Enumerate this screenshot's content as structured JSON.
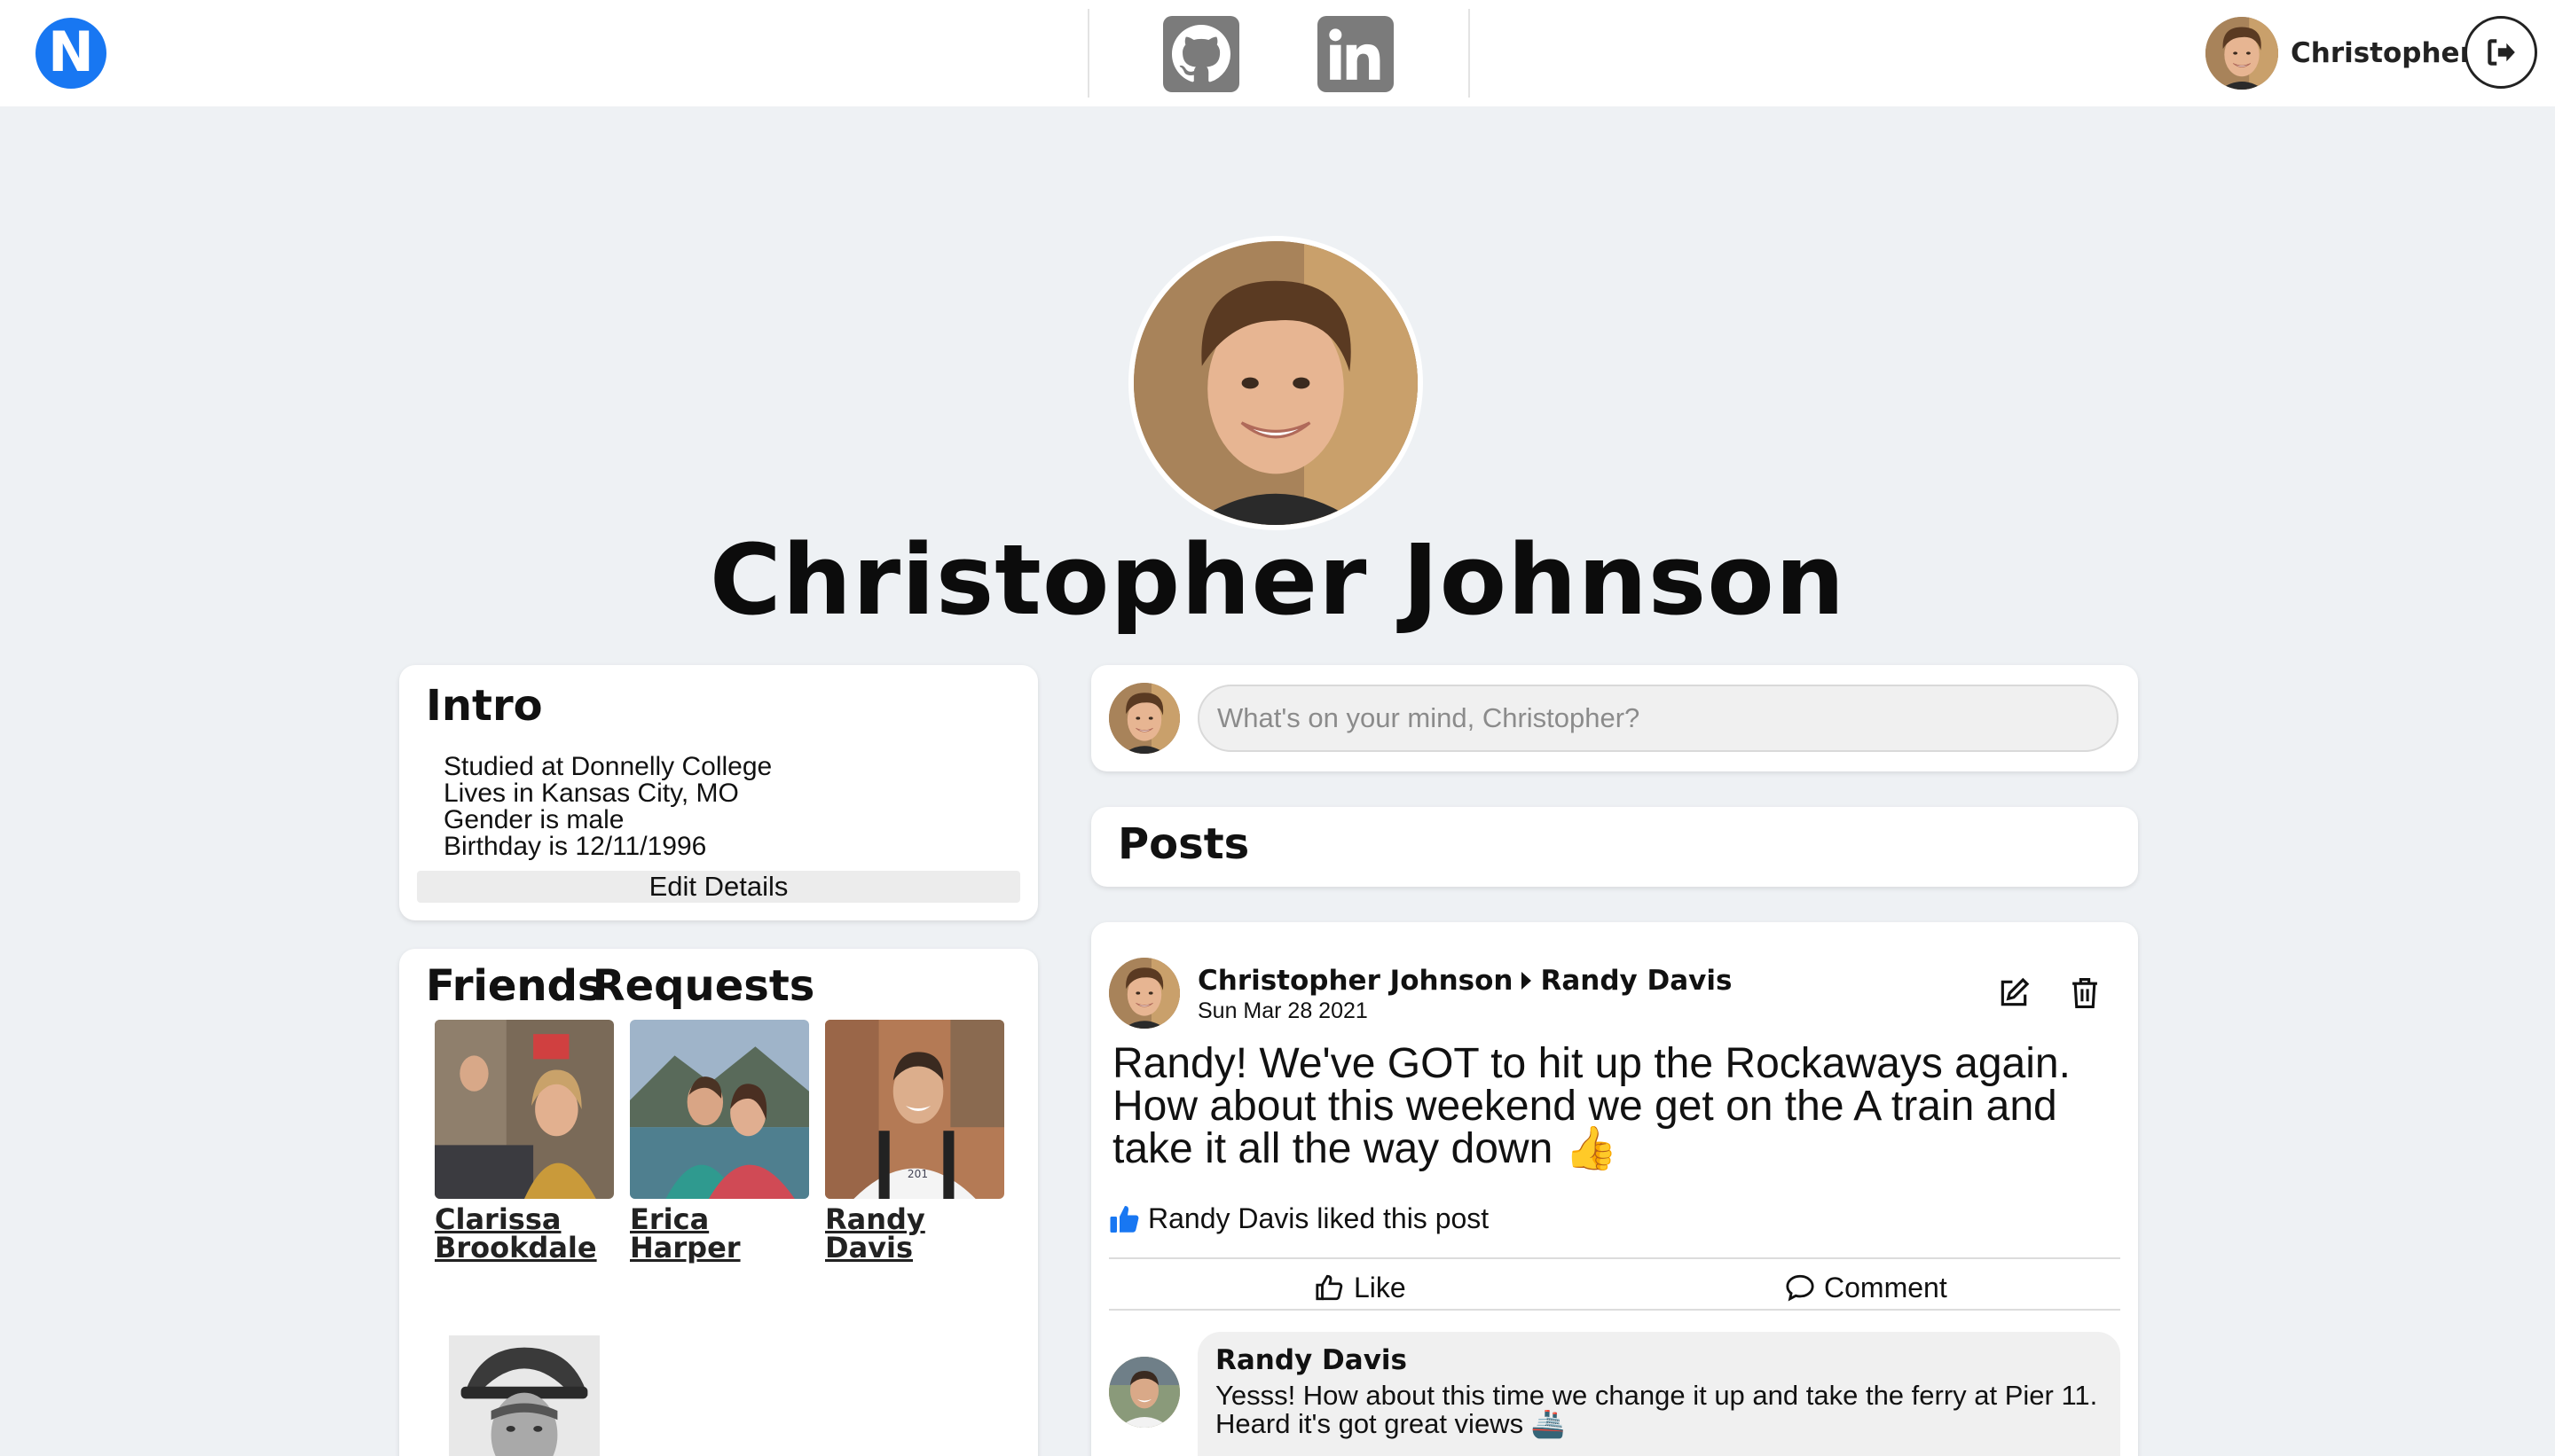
{
  "app": {
    "logo_letter": "N",
    "brand_color": "#1877f2"
  },
  "topbar": {
    "social": [
      {
        "name": "github-icon"
      },
      {
        "name": "linkedin-icon"
      }
    ],
    "user": {
      "first_name": "Christopher"
    }
  },
  "profile": {
    "full_name": "Christopher Johnson"
  },
  "intro": {
    "title": "Intro",
    "lines": [
      "Studied at Donnelly College",
      "Lives in Kansas City, MO",
      "Gender is male",
      "Birthday is 12/11/1996"
    ],
    "edit_label": "Edit Details"
  },
  "friends": {
    "title": "Friends",
    "list": [
      {
        "name": "Clarissa Brookdale"
      },
      {
        "name": "Erica Harper"
      },
      {
        "name": "Randy Davis"
      }
    ],
    "requests_title": "Friend Requests"
  },
  "composer": {
    "placeholder": "What's on your mind, Christopher?"
  },
  "posts": {
    "title": "Posts",
    "items": [
      {
        "author": "Christopher Johnson",
        "recipient": "Randy Davis",
        "date": "Sun Mar 28 2021",
        "text": "Randy! We've GOT to hit up the Rockaways again. How about this weekend we get on the A train and take it all the way down 👍",
        "likes_text": "Randy Davis liked this post",
        "like_label": "Like",
        "comment_label": "Comment",
        "comments": [
          {
            "author": "Randy Davis",
            "text": "Yesss! How about this time we change it up and take the ferry at Pier 11. Heard it's got great views 🚢"
          }
        ]
      }
    ]
  }
}
